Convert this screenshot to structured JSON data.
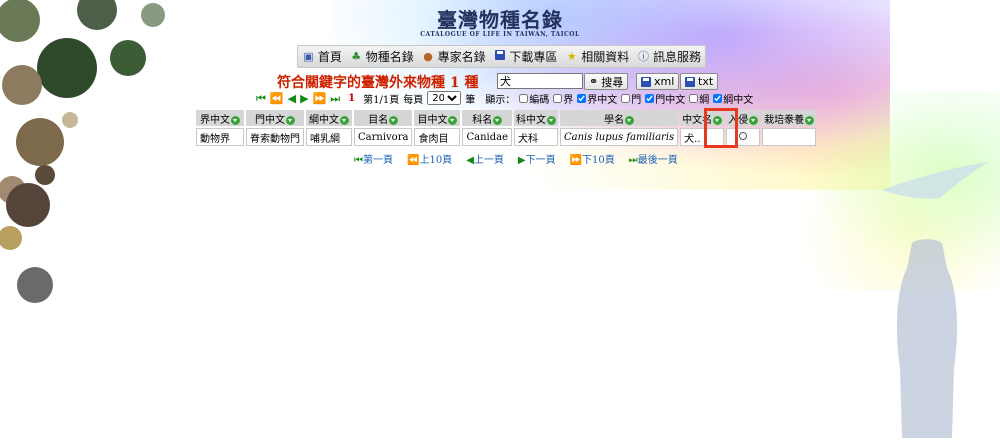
{
  "header": {
    "logo_title": "臺灣物種名錄",
    "logo_subtitle": "CATALOGUE OF LIFE IN TAIWAN, TAICOL"
  },
  "nav": {
    "items": [
      {
        "label": "首頁",
        "icon": "home-icon"
      },
      {
        "label": "物種名錄",
        "icon": "tree-icon"
      },
      {
        "label": "專家名錄",
        "icon": "expert-icon"
      },
      {
        "label": "下載專區",
        "icon": "save-icon"
      },
      {
        "label": "相關資料",
        "icon": "star-icon"
      },
      {
        "label": "訊息服務",
        "icon": "info-icon"
      }
    ]
  },
  "search": {
    "result_title": "符合關鍵字的臺灣外來物種 1 種",
    "query_value": "犬",
    "search_button": "搜尋",
    "xml_button": "xml",
    "txt_button": "txt"
  },
  "pager": {
    "current_page": "1",
    "page_info": "第1/1頁",
    "per_page_label": "每頁",
    "per_page_value": "20",
    "per_page_unit": "筆",
    "display_label": "顯示：",
    "columns_toggle": [
      {
        "label": "編碼",
        "checked": false
      },
      {
        "label": "界",
        "checked": false
      },
      {
        "label": "界中文",
        "checked": true
      },
      {
        "label": "門",
        "checked": false
      },
      {
        "label": "門中文",
        "checked": true
      },
      {
        "label": "綱",
        "checked": false
      },
      {
        "label": "綱中文",
        "checked": true
      }
    ]
  },
  "table": {
    "headers": [
      "界中文",
      "門中文",
      "綱中文",
      "目名",
      "目中文",
      "科名",
      "科中文",
      "學名",
      "中文名",
      "入侵",
      "栽培豢養"
    ],
    "rows": [
      [
        "動物界",
        "脊索動物門",
        "哺乳綱",
        "Carnivora",
        "食肉目",
        "Canidae",
        "犬科",
        "Canis lupus familiaris",
        "犬..",
        "",
        ""
      ]
    ]
  },
  "bottom_pager": {
    "first": "第一頁",
    "prev10": "上10頁",
    "prev": "上一頁",
    "next": "下一頁",
    "next10": "下10頁",
    "last": "最後一頁"
  },
  "colors": {
    "title_red": "#cc2200",
    "pager_green": "#138a13",
    "link_blue": "#1a5fb4",
    "highlight": "#e53a1f"
  }
}
